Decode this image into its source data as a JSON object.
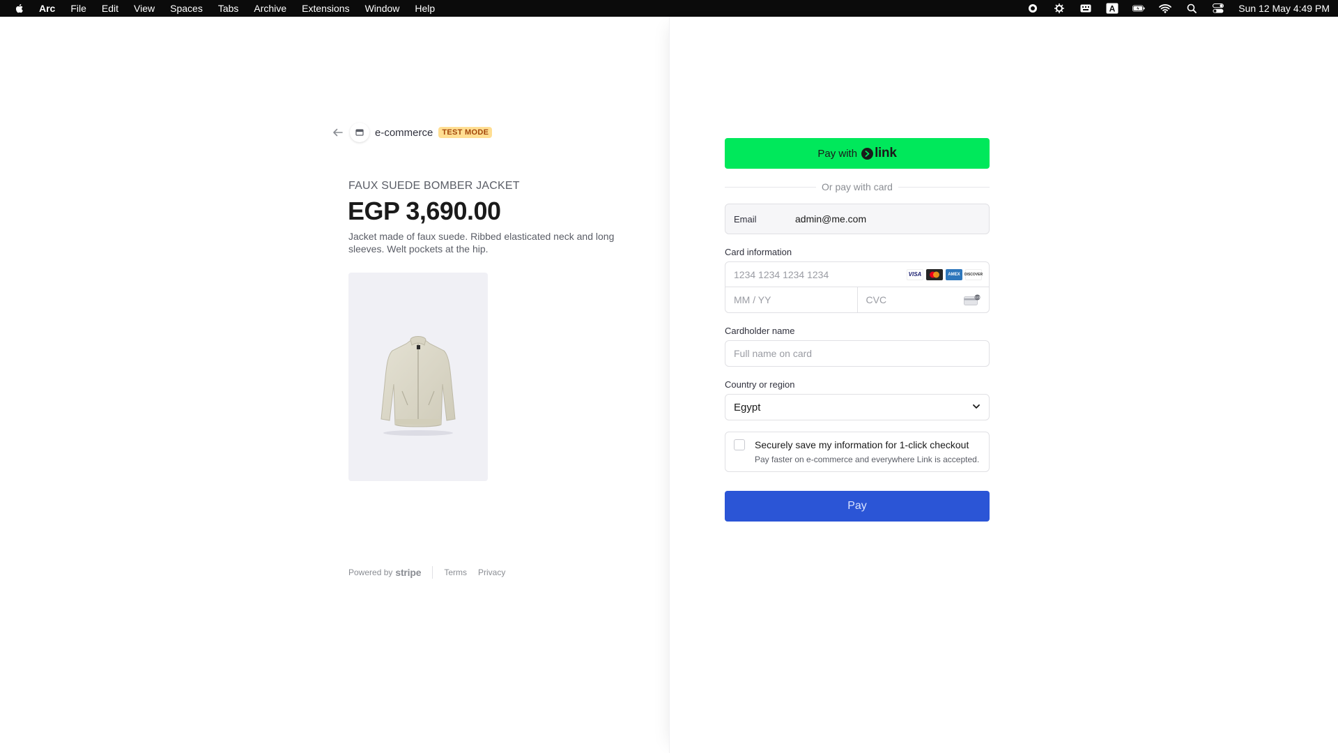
{
  "menubar": {
    "app_name": "Arc",
    "items": [
      "File",
      "Edit",
      "View",
      "Spaces",
      "Tabs",
      "Archive",
      "Extensions",
      "Window",
      "Help"
    ],
    "clock": "Sun 12 May  4:49 PM"
  },
  "merchant": {
    "store_name": "e-commerce",
    "badge": "TEST MODE"
  },
  "product": {
    "name": "FAUX SUEDE BOMBER JACKET",
    "price": "EGP 3,690.00",
    "description": "Jacket made of faux suede. Ribbed elasticated neck and long sleeves. Welt pockets at the hip."
  },
  "footer": {
    "powered_by": "Powered by",
    "brand": "stripe",
    "terms": "Terms",
    "privacy": "Privacy"
  },
  "payment": {
    "link_button_prefix": "Pay with",
    "link_brand": "link",
    "divider_text": "Or pay with card",
    "email_label": "Email",
    "email_value": "admin@me.com",
    "card_info_label": "Card information",
    "card_number_placeholder": "1234 1234 1234 1234",
    "expiry_placeholder": "MM / YY",
    "cvc_placeholder": "CVC",
    "card_brands": [
      "VISA",
      "mastercard",
      "AMEX",
      "DISCOVER"
    ],
    "cardholder_label": "Cardholder name",
    "cardholder_placeholder": "Full name on card",
    "country_label": "Country or region",
    "country_value": "Egypt",
    "save_title": "Securely save my information for 1-click checkout",
    "save_subtitle": "Pay faster on e-commerce and everywhere Link is accepted.",
    "pay_label": "Pay",
    "colors": {
      "link_green": "#00e85b",
      "pay_blue": "#2b55d6",
      "badge_bg": "#ffde92",
      "badge_text": "#a2470b"
    }
  }
}
